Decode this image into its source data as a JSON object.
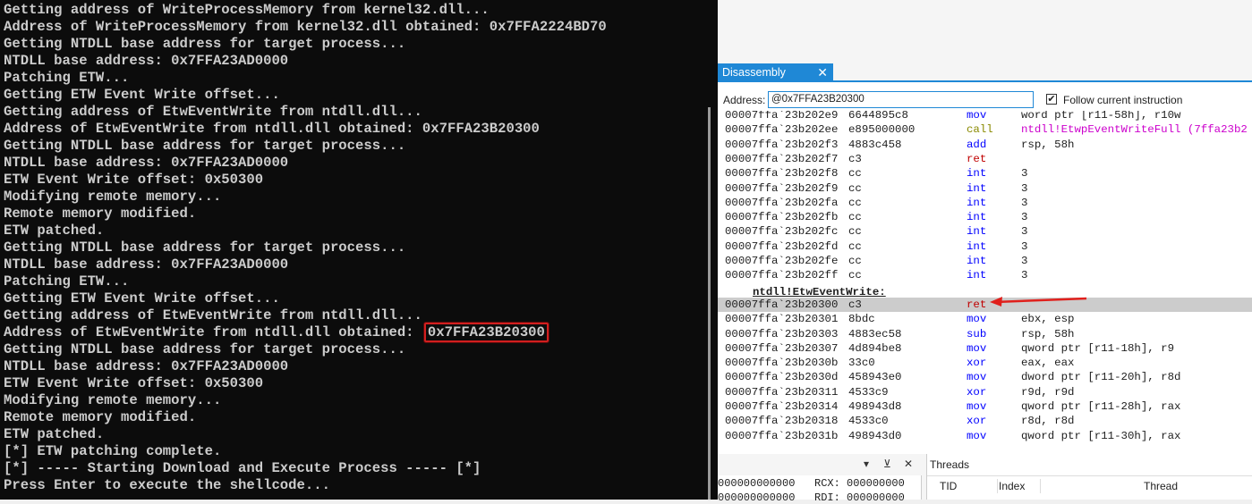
{
  "console": {
    "lines": [
      "Getting address of WriteProcessMemory from kernel32.dll...",
      "Address of WriteProcessMemory from kernel32.dll obtained: 0x7FFA2224BD70",
      "Getting NTDLL base address for target process...",
      "NTDLL base address: 0x7FFA23AD0000",
      "Patching ETW...",
      "Getting ETW Event Write offset...",
      "Getting address of EtwEventWrite from ntdll.dll...",
      "Address of EtwEventWrite from ntdll.dll obtained: 0x7FFA23B20300",
      "Getting NTDLL base address for target process...",
      "NTDLL base address: 0x7FFA23AD0000",
      "ETW Event Write offset: 0x50300",
      "Modifying remote memory...",
      "Remote memory modified.",
      "ETW patched.",
      "Getting NTDLL base address for target process...",
      "NTDLL base address: 0x7FFA23AD0000",
      "Patching ETW...",
      "Getting ETW Event Write offset...",
      "Getting address of EtwEventWrite from ntdll.dll...",
      "Address of EtwEventWrite from ntdll.dll obtained: ",
      "Getting NTDLL base address for target process...",
      "NTDLL base address: 0x7FFA23AD0000",
      "ETW Event Write offset: 0x50300",
      "Modifying remote memory...",
      "Remote memory modified.",
      "ETW patched.",
      "[*] ETW patching complete.",
      "[*] ----- Starting Download and Execute Process ----- [*]",
      "Press Enter to execute the shellcode..."
    ],
    "highlighted_value": "0x7FFA23B20300"
  },
  "debugger": {
    "tab_label": "Disassembly",
    "tab_close": "✕",
    "address_label": "Address:",
    "address_value": "@0x7FFA23B20300",
    "follow_label": "Follow current instruction",
    "follow_checked": "✔",
    "label_line": "ntdll!EtwEventWrite:",
    "rows_before": [
      {
        "addr": "00007ffa`23b202e9",
        "bytes": "6644895c8",
        "mn": "mov",
        "op": "word ptr [r11-58h], r10w",
        "color": "#0000ff"
      },
      {
        "addr": "00007ffa`23b202ee",
        "bytes": "e895000000",
        "mn": "call",
        "op": "ntdll!EtwpEventWriteFull (7ffa23b2",
        "color": "#8a8a00",
        "op_color": "#cc00cc"
      },
      {
        "addr": "00007ffa`23b202f3",
        "bytes": "4883c458",
        "mn": "add",
        "op": "rsp, 58h",
        "color": "#0000ff"
      },
      {
        "addr": "00007ffa`23b202f7",
        "bytes": "c3",
        "mn": "ret",
        "op": "",
        "color": "#c00000"
      },
      {
        "addr": "00007ffa`23b202f8",
        "bytes": "cc",
        "mn": "int",
        "op": "3",
        "color": "#0000ff"
      },
      {
        "addr": "00007ffa`23b202f9",
        "bytes": "cc",
        "mn": "int",
        "op": "3",
        "color": "#0000ff"
      },
      {
        "addr": "00007ffa`23b202fa",
        "bytes": "cc",
        "mn": "int",
        "op": "3",
        "color": "#0000ff"
      },
      {
        "addr": "00007ffa`23b202fb",
        "bytes": "cc",
        "mn": "int",
        "op": "3",
        "color": "#0000ff"
      },
      {
        "addr": "00007ffa`23b202fc",
        "bytes": "cc",
        "mn": "int",
        "op": "3",
        "color": "#0000ff"
      },
      {
        "addr": "00007ffa`23b202fd",
        "bytes": "cc",
        "mn": "int",
        "op": "3",
        "color": "#0000ff"
      },
      {
        "addr": "00007ffa`23b202fe",
        "bytes": "cc",
        "mn": "int",
        "op": "3",
        "color": "#0000ff"
      },
      {
        "addr": "00007ffa`23b202ff",
        "bytes": "cc",
        "mn": "int",
        "op": "3",
        "color": "#0000ff"
      }
    ],
    "rows_after": [
      {
        "addr": "00007ffa`23b20300",
        "bytes": "c3",
        "mn": "ret",
        "op": "",
        "color": "#c00000",
        "current": true
      },
      {
        "addr": "00007ffa`23b20301",
        "bytes": "8bdc",
        "mn": "mov",
        "op": "ebx, esp",
        "color": "#0000ff"
      },
      {
        "addr": "00007ffa`23b20303",
        "bytes": "4883ec58",
        "mn": "sub",
        "op": "rsp, 58h",
        "color": "#0000ff"
      },
      {
        "addr": "00007ffa`23b20307",
        "bytes": "4d894be8",
        "mn": "mov",
        "op": "qword ptr [r11-18h], r9",
        "color": "#0000ff"
      },
      {
        "addr": "00007ffa`23b2030b",
        "bytes": "33c0",
        "mn": "xor",
        "op": "eax, eax",
        "color": "#0000ff"
      },
      {
        "addr": "00007ffa`23b2030d",
        "bytes": "458943e0",
        "mn": "mov",
        "op": "dword ptr [r11-20h], r8d",
        "color": "#0000ff"
      },
      {
        "addr": "00007ffa`23b20311",
        "bytes": "4533c9",
        "mn": "xor",
        "op": "r9d, r9d",
        "color": "#0000ff"
      },
      {
        "addr": "00007ffa`23b20314",
        "bytes": "498943d8",
        "mn": "mov",
        "op": "qword ptr [r11-28h], rax",
        "color": "#0000ff"
      },
      {
        "addr": "00007ffa`23b20318",
        "bytes": "4533c0",
        "mn": "xor",
        "op": "r8d, r8d",
        "color": "#0000ff"
      },
      {
        "addr": "00007ffa`23b2031b",
        "bytes": "498943d0",
        "mn": "mov",
        "op": "qword ptr [r11-30h], rax",
        "color": "#0000ff"
      }
    ],
    "registers": {
      "line1": "000000000000   RCX: 000000000",
      "line2": "000000000000   RDI: 000000000"
    },
    "threads": {
      "title": "Threads",
      "col_tid": "TID",
      "col_index": "Index",
      "col_thread": "Thread"
    }
  },
  "colors": {
    "accent": "#1f88d6",
    "console_bg": "#0c0c0c",
    "console_fg": "#cccccc",
    "highlight_border": "#d21f1f",
    "current_row": "#cccccc"
  }
}
